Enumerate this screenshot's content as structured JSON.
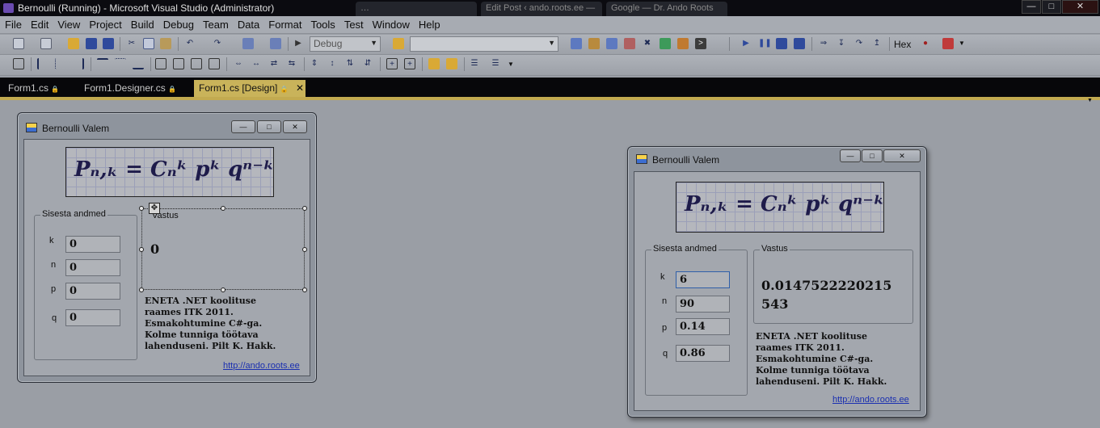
{
  "window": {
    "title": "Bernoulli (Running) - Microsoft Visual Studio (Administrator)",
    "bg_tabs": [
      "… ",
      "Edit Post ‹ ando.roots.ee —",
      "Google — Dr. Ando Roots"
    ]
  },
  "menu": [
    "File",
    "Edit",
    "View",
    "Project",
    "Build",
    "Debug",
    "Team",
    "Data",
    "Format",
    "Tools",
    "Test",
    "Window",
    "Help"
  ],
  "toolbar": {
    "config_combo": "Debug",
    "platform_combo": "",
    "hex_label": "Hex"
  },
  "doc_tabs": [
    {
      "label": "Form1.cs",
      "lock": "🔒"
    },
    {
      "label": "Form1.Designer.cs",
      "lock": "🔒"
    },
    {
      "label": "Form1.cs [Design]",
      "lock": "🔒",
      "close": "✕"
    }
  ],
  "design_form": {
    "title": "Bernoulli Valem",
    "formula": "Pₙ,ₖ = Cₙᵏ pᵏ qⁿ⁻ᵏ",
    "input_group": "Sisesta andmed",
    "answer_group": "Vastus",
    "labels": [
      "k",
      "n",
      "p",
      "q"
    ],
    "values": [
      "0",
      "0",
      "0",
      "0"
    ],
    "answer": "0",
    "description": "ENETA .NET koolituse raames ITK 2011. Esmakohtumine C#-ga. Kolme tunniga töötava lahenduseni. Pilt K. Hakk.",
    "link": "http://ando.roots.ee"
  },
  "running_form": {
    "title": "Bernoulli Valem",
    "formula": "Pₙ,ₖ = Cₙᵏ pᵏ qⁿ⁻ᵏ",
    "input_group": "Sisesta andmed",
    "answer_group": "Vastus",
    "labels": [
      "k",
      "n",
      "p",
      "q"
    ],
    "values": [
      "6",
      "90",
      "0.14",
      "0.86"
    ],
    "answer_line1": "0.0147522220215",
    "answer_line2": "543",
    "description": "ENETA .NET koolituse raames ITK 2011. Esmakohtumine C#-ga. Kolme tunniga töötava lahenduseni. Pilt K. Hakk.",
    "link": "http://ando.roots.ee"
  },
  "glyphs": {
    "min": "—",
    "max": "□",
    "close": "✕",
    "arrow": "▼",
    "move": "✥"
  }
}
